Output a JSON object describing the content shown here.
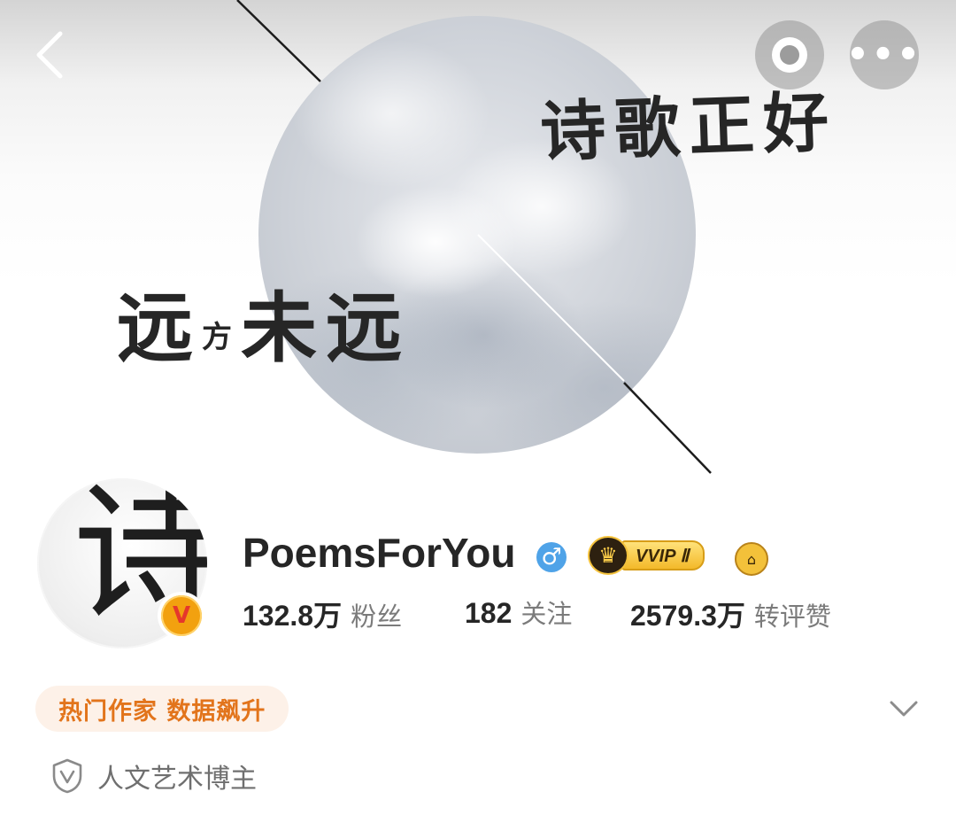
{
  "cover": {
    "calligraphy_top": "诗歌正好",
    "calligraphy_left_a": "远",
    "calligraphy_left_small": "方",
    "calligraphy_left_b": "未远"
  },
  "nav": {
    "back_icon": "chevron-left-icon",
    "target_icon": "target-icon",
    "more_icon": "more-dots-icon",
    "more_glyph": "•••"
  },
  "profile": {
    "avatar_glyph": "诗",
    "verified_badge": "V",
    "name": "PoemsForYou",
    "gender_glyph": "♂",
    "vip_label": "VVIP Ⅱ",
    "vip_crown": "♛",
    "medal_glyph": "⌂"
  },
  "stats": [
    {
      "value": "132.8万",
      "label": "粉丝"
    },
    {
      "value": "182",
      "label": "关注"
    },
    {
      "value": "2579.3万",
      "label": "转评赞"
    }
  ],
  "tag": {
    "text": "热门作家 数据飙升"
  },
  "category": {
    "text": "人文艺术博主",
    "icon": "shield-v-icon"
  },
  "colors": {
    "accent_orange": "#e2741b",
    "tag_bg": "#fdf1e8",
    "gender_blue": "#4fa3e8",
    "vip_gold": "#f3b92a",
    "verified_orange": "#f2a10f"
  }
}
